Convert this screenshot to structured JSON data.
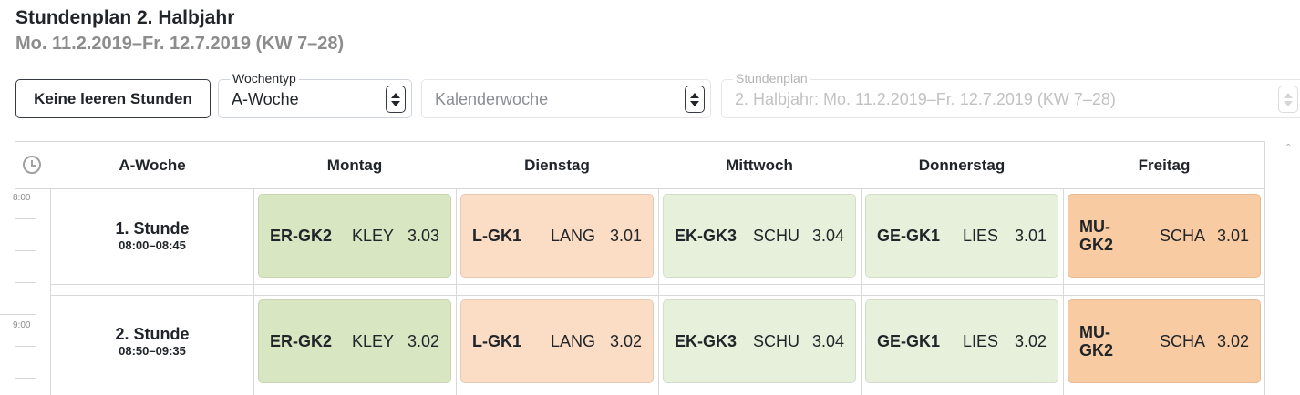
{
  "page": {
    "title": "Stundenplan 2. Halbjahr",
    "subtitle": "Mo. 11.2.2019–Fr. 12.7.2019 (KW 7–28)"
  },
  "controls": {
    "empty_button_label": "Keine leeren Stunden",
    "week_type": {
      "label": "Wochentyp",
      "value": "A-Woche"
    },
    "calendar_week": {
      "placeholder": "Kalenderwoche"
    },
    "plan": {
      "label": "Stundenplan",
      "value": "2. Halbjahr: Mo. 11.2.2019–Fr. 12.7.2019 (KW 7–28)"
    }
  },
  "timetable": {
    "week_label": "A-Woche",
    "days": [
      "Montag",
      "Dienstag",
      "Mittwoch",
      "Donnerstag",
      "Freitag"
    ],
    "time_axis": [
      "8:00",
      "9:00"
    ],
    "lessons": [
      {
        "name": "1. Stunde",
        "time": "08:00–08:45",
        "cells": [
          {
            "subject": "ER-GK2",
            "teacher": "KLEY",
            "room": "3.03"
          },
          {
            "subject": "L-GK1",
            "teacher": "LANG",
            "room": "3.01"
          },
          {
            "subject": "EK-GK3",
            "teacher": "SCHU",
            "room": "3.04"
          },
          {
            "subject": "GE-GK1",
            "teacher": "LIES",
            "room": "3.01"
          },
          {
            "subject": "MU-GK2",
            "teacher": "SCHA",
            "room": "3.01"
          }
        ]
      },
      {
        "name": "2. Stunde",
        "time": "08:50–09:35",
        "cells": [
          {
            "subject": "ER-GK2",
            "teacher": "KLEY",
            "room": "3.02"
          },
          {
            "subject": "L-GK1",
            "teacher": "LANG",
            "room": "3.02"
          },
          {
            "subject": "EK-GK3",
            "teacher": "SCHU",
            "room": "3.04"
          },
          {
            "subject": "GE-GK1",
            "teacher": "LIES",
            "room": "3.02"
          },
          {
            "subject": "MU-GK2",
            "teacher": "SCHA",
            "room": "3.02"
          }
        ]
      }
    ]
  },
  "colors": {
    "ER-GK2": "#d9e6c2",
    "L-GK1": "#fbdcc4",
    "EK-GK3": "#e6f0db",
    "GE-GK1": "#e6f0db",
    "MU-GK2": "#f9cba2"
  }
}
